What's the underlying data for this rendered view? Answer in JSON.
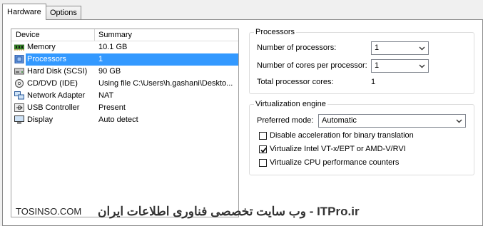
{
  "tabs": [
    {
      "label": "Hardware",
      "active": true
    },
    {
      "label": "Options",
      "active": false
    }
  ],
  "device_list": {
    "columns": [
      "Device",
      "Summary"
    ],
    "rows": [
      {
        "icon": "memory-icon",
        "device": "Memory",
        "summary": "10.1 GB",
        "selected": false
      },
      {
        "icon": "processor-icon",
        "device": "Processors",
        "summary": "1",
        "selected": true
      },
      {
        "icon": "hard-disk-icon",
        "device": "Hard Disk (SCSI)",
        "summary": "90 GB",
        "selected": false
      },
      {
        "icon": "cd-dvd-icon",
        "device": "CD/DVD (IDE)",
        "summary": "Using file C:\\Users\\h.gashani\\Deskto...",
        "selected": false
      },
      {
        "icon": "network-adapter-icon",
        "device": "Network Adapter",
        "summary": "NAT",
        "selected": false
      },
      {
        "icon": "usb-icon",
        "device": "USB Controller",
        "summary": "Present",
        "selected": false
      },
      {
        "icon": "display-icon",
        "device": "Display",
        "summary": "Auto detect",
        "selected": false
      }
    ]
  },
  "processors": {
    "title": "Processors",
    "num_processors_label": "Number of processors:",
    "num_processors_value": "1",
    "cores_label": "Number of cores per processor:",
    "cores_value": "1",
    "total_label": "Total processor cores:",
    "total_value": "1"
  },
  "virtualization": {
    "title": "Virtualization engine",
    "mode_label": "Preferred mode:",
    "mode_value": "Automatic",
    "options": [
      {
        "label": "Disable acceleration for binary translation",
        "checked": false
      },
      {
        "label": "Virtualize Intel VT-x/EPT or AMD-V/RVI",
        "checked": true
      },
      {
        "label": "Virtualize CPU performance counters",
        "checked": false
      }
    ]
  },
  "watermark": {
    "left": "TOSINSO.COM",
    "right": "وب سایت تخصصی فناوری اطلاعات ایران - ITPro.ir"
  }
}
